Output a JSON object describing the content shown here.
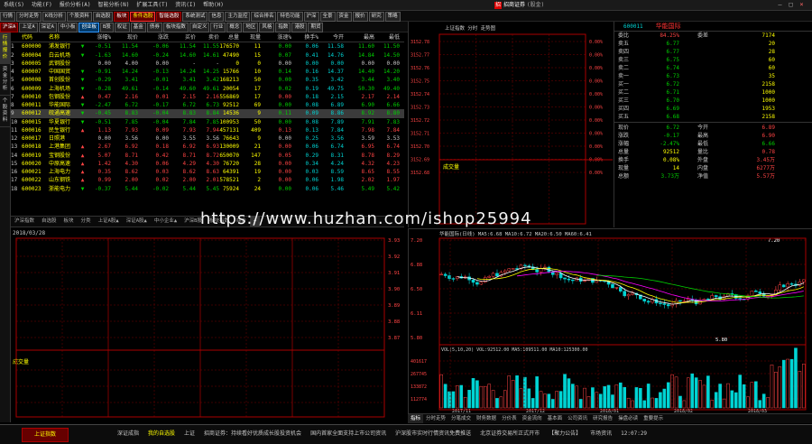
{
  "menu": {
    "items": [
      "系统(S)",
      "功能(F)",
      "报价分析(A)",
      "智能分析(N)",
      "扩展工具(T)",
      "资讯(I)",
      "帮助(H)"
    ],
    "brand": "招商证券",
    "brand_sub": "(股金)"
  },
  "toolbar1": [
    "行情",
    "分时走势",
    "K线分析",
    "个股资料",
    "自选股",
    "板块",
    "条件选股",
    "智能选股",
    "系统测试",
    "信息",
    "主力监控",
    "综合排名",
    "特色功能",
    "沪深",
    "全景",
    "资金",
    "报价",
    "研究",
    "策略"
  ],
  "toolbar2": [
    "沪深A",
    "上证A",
    "深证A",
    "中小板",
    "创业板",
    "B股",
    "权证",
    "基金",
    "债券",
    "板块指数",
    "自定义",
    "行业",
    "概念",
    "地区",
    "风格",
    "指数",
    "港股",
    "期货"
  ],
  "left_tabs": [
    "行情报价",
    "资金分析",
    "个股资料"
  ],
  "quotes": {
    "headers": [
      "",
      "代码",
      "名称",
      "",
      "涨幅%",
      "现价",
      "涨跌",
      "买价",
      "卖价",
      "总量",
      "现量",
      "涨速%",
      "换手%",
      "今开",
      "最高",
      "最低",
      "昨收",
      "市盈"
    ],
    "rows": [
      {
        "n": "1",
        "code": "600000",
        "name": "浦发银行",
        "f": "dn",
        "v": [
          "-0.51",
          "11.54",
          "-0.06",
          "11.54",
          "11.55",
          "176570",
          "11",
          "0.00",
          "0.06",
          "11.58",
          "11.60",
          "11.50",
          "11.60",
          "6.12"
        ]
      },
      {
        "n": "2",
        "code": "600004",
        "name": "白云机场",
        "f": "dn",
        "v": [
          "-1.63",
          "14.60",
          "-0.24",
          "14.60",
          "14.61",
          "47490",
          "15",
          "0.07",
          "0.41",
          "14.76",
          "14.84",
          "14.50",
          "14.84",
          "15.23"
        ]
      },
      {
        "n": "3",
        "code": "600005",
        "name": "武钢股份",
        "f": "fl",
        "v": [
          "0.00",
          "4.00",
          "0.00",
          "-",
          "-",
          "0",
          "0",
          "0.00",
          "0.00",
          "0.00",
          "0.00",
          "0.00",
          "4.00",
          "4.05"
        ]
      },
      {
        "n": "4",
        "code": "600007",
        "name": "中国国贸",
        "f": "dn",
        "v": [
          "-0.91",
          "14.24",
          "-0.13",
          "14.24",
          "14.25",
          "15766",
          "10",
          "0.14",
          "0.16",
          "14.37",
          "14.40",
          "14.20",
          "14.37",
          "20.88"
        ]
      },
      {
        "n": "5",
        "code": "600008",
        "name": "首创股份",
        "f": "dn",
        "v": [
          "-0.29",
          "3.41",
          "-0.01",
          "3.41",
          "3.42",
          "168213",
          "50",
          "0.00",
          "0.35",
          "3.42",
          "3.44",
          "3.40",
          "3.42",
          "25.14"
        ]
      },
      {
        "n": "6",
        "code": "600009",
        "name": "上海机场",
        "f": "dn",
        "v": [
          "-0.28",
          "49.61",
          "-0.14",
          "49.60",
          "49.61",
          "20054",
          "17",
          "0.02",
          "0.19",
          "49.75",
          "50.30",
          "49.40",
          "49.75",
          "30.70"
        ]
      },
      {
        "n": "7",
        "code": "600010",
        "name": "包钢股份",
        "f": "up",
        "v": [
          "0.47",
          "2.16",
          "0.01",
          "2.15",
          "2.16",
          "556869",
          "17",
          "0.00",
          "0.18",
          "2.15",
          "2.17",
          "2.14",
          "2.15",
          "215"
        ]
      },
      {
        "n": "8",
        "code": "600011",
        "name": "华能国际",
        "f": "dn",
        "v": [
          "-2.47",
          "6.72",
          "-0.17",
          "6.72",
          "6.73",
          "92512",
          "69",
          "0.00",
          "0.08",
          "6.89",
          "6.90",
          "6.66",
          "6.89",
          "14.09"
        ]
      },
      {
        "n": "9",
        "code": "600012",
        "name": "皖通高速",
        "f": "dn",
        "v": [
          "-0.45",
          "8.83",
          "-0.04",
          "8.83",
          "8.84",
          "14536",
          "9",
          "0.11",
          "0.09",
          "8.86",
          "8.92",
          "8.80",
          "8.87",
          "9.42"
        ]
      },
      {
        "n": "10",
        "code": "600015",
        "name": "华夏银行",
        "f": "dn",
        "v": [
          "-0.51",
          "7.85",
          "-0.04",
          "7.84",
          "7.85",
          "100953",
          "50",
          "0.00",
          "0.08",
          "7.89",
          "7.91",
          "7.83",
          "7.89",
          "6.89"
        ]
      },
      {
        "n": "11",
        "code": "600016",
        "name": "民生银行",
        "f": "up",
        "v": [
          "1.13",
          "7.93",
          "0.09",
          "7.93",
          "7.94",
          "457131",
          "409",
          "0.13",
          "0.13",
          "7.84",
          "7.98",
          "7.84",
          "7.84",
          "7.20"
        ]
      },
      {
        "n": "12",
        "code": "600017",
        "name": "日照港",
        "f": "fl",
        "v": [
          "0.00",
          "3.56",
          "0.00",
          "3.55",
          "3.56",
          "76643",
          "9",
          "0.00",
          "0.25",
          "3.56",
          "3.59",
          "3.53",
          "3.56",
          "39.19"
        ]
      },
      {
        "n": "13",
        "code": "600018",
        "name": "上港集团",
        "f": "up",
        "v": [
          "2.67",
          "6.92",
          "0.18",
          "6.92",
          "6.93",
          "130009",
          "21",
          "0.00",
          "0.06",
          "6.74",
          "6.95",
          "6.74",
          "6.74",
          "7.11"
        ]
      },
      {
        "n": "14",
        "code": "600019",
        "name": "宝钢股份",
        "f": "up",
        "v": [
          "5.07",
          "8.71",
          "0.42",
          "8.71",
          "8.72",
          "650070",
          "147",
          "0.05",
          "0.29",
          "8.31",
          "8.78",
          "8.29",
          "8.29",
          "8.68"
        ]
      },
      {
        "n": "15",
        "code": "600020",
        "name": "中原高速",
        "f": "up",
        "v": [
          "1.42",
          "4.30",
          "0.06",
          "4.29",
          "4.30",
          "76720",
          "28",
          "0.00",
          "0.34",
          "4.24",
          "4.32",
          "4.23",
          "4.24",
          "6.36"
        ]
      },
      {
        "n": "16",
        "code": "600021",
        "name": "上海电力",
        "f": "up",
        "v": [
          "0.35",
          "8.62",
          "0.03",
          "8.62",
          "8.63",
          "64391",
          "19",
          "0.00",
          "0.03",
          "8.59",
          "8.65",
          "8.55",
          "8.59",
          "10.33"
        ]
      },
      {
        "n": "17",
        "code": "600022",
        "name": "山东钢铁",
        "f": "up",
        "v": [
          "0.99",
          "2.00",
          "0.02",
          "2.00",
          "2.01",
          "578521",
          "2",
          "0.00",
          "0.06",
          "1.98",
          "2.02",
          "1.97",
          "1.98",
          "2.00"
        ]
      },
      {
        "n": "18",
        "code": "600023",
        "name": "浙能电力",
        "f": "dn",
        "v": [
          "-0.37",
          "5.44",
          "-0.02",
          "5.44",
          "5.45",
          "75924",
          "24",
          "0.00",
          "0.06",
          "5.46",
          "5.49",
          "5.42",
          "5.46",
          "16.01"
        ]
      }
    ]
  },
  "sheet_tabs": [
    "沪深指数",
    "自选股",
    "板块",
    "分类",
    "上证A股▲",
    "深证A股▲",
    "中小企业▲",
    "沪深B股",
    "板块指数",
    "综合",
    "+"
  ],
  "intraday": {
    "date": "2018/03/28",
    "label": "成交量",
    "yticks": [
      "3.93",
      "3.92",
      "3.91",
      "3.90",
      "3.89",
      "3.88",
      "3.87"
    ]
  },
  "mid_chart": {
    "title": "上证指数  分时  走势图",
    "yticks": [
      "3152.78",
      "3152.77",
      "3152.76",
      "3152.75",
      "3152.74",
      "3152.73",
      "3152.72",
      "3152.71",
      "3152.70",
      "3152.69",
      "3152.68"
    ],
    "pct": [
      "0.00%",
      "0.00%",
      "0.00%",
      "0.00%",
      "0.00%",
      "0.00%",
      "0.00%",
      "0.00%",
      "0.00%",
      "0.00%",
      "0.00%"
    ],
    "vol_label": "成交量"
  },
  "right_panel": {
    "code": "600011",
    "name": "华能国际",
    "rows": [
      [
        "委比",
        "84.25%",
        "委差",
        "7174"
      ],
      [
        "卖五",
        "6.77",
        "",
        "20"
      ],
      [
        "卖四",
        "6.77",
        "",
        "28"
      ],
      [
        "卖三",
        "6.75",
        "",
        "60"
      ],
      [
        "卖二",
        "6.74",
        "",
        "60"
      ],
      [
        "卖一",
        "6.73",
        "",
        "35"
      ],
      [
        "买一",
        "6.72",
        "",
        "2158"
      ],
      [
        "买二",
        "6.71",
        "",
        "1000"
      ],
      [
        "买三",
        "6.70",
        "",
        "1000"
      ],
      [
        "买四",
        "6.69",
        "",
        "1953"
      ],
      [
        "买五",
        "6.68",
        "",
        "2158"
      ]
    ],
    "stats": [
      [
        "现价",
        "6.72",
        "今开",
        "6.89"
      ],
      [
        "涨跌",
        "-0.17",
        "最高",
        "6.90"
      ],
      [
        "涨幅",
        "-2.47%",
        "最低",
        "6.66"
      ],
      [
        "总量",
        "92512",
        "量比",
        "0.78"
      ],
      [
        "换手",
        "0.08%",
        "外盘",
        "3.45万"
      ],
      [
        "现量",
        "14",
        "内盘",
        "6277万"
      ],
      [
        "总额",
        "3.73万",
        "净值",
        "5.57万"
      ]
    ]
  },
  "kline": {
    "title": "华能国际(日线)  MA5:6.68  MA10:6.72  MA20:6.50  MA60:6.41",
    "yticks": [
      "7.20",
      "6.88",
      "6.50",
      "6.11",
      "5.80"
    ],
    "hi_label": "7.20",
    "lo_label": "5.80",
    "vol_title": "VOL(5,10,20)  VOL:92512.00  MA5:109511.00  MA10:125300.00",
    "vol_ticks": [
      "401617",
      "267745",
      "133872",
      "112774"
    ],
    "months": [
      "2017/11",
      "2017/12",
      "2018/01",
      "2018/02",
      "2018/03"
    ],
    "tabs": [
      "指标",
      "分时走势",
      "分笔成交",
      "财务数据",
      "分价表",
      "资金流向",
      "基本面",
      "公司资讯",
      "研究报告",
      "操盘必读",
      "重要提示"
    ]
  },
  "status": {
    "left_btn": "上证指数",
    "items": [
      "深证成指",
      "我的自选股",
      "上证",
      "招商证券：持续看好优质成长股投资机会",
      "国内首家全面支持上市公司资讯",
      "沪深股市实时行情资讯免费推送",
      "北京证券交易所正式开市",
      "【聚力公告】",
      "市场资讯",
      "12:07:29"
    ],
    "time": "12:07:29"
  },
  "watermark": "https://www.huzhan.com/ishop25994",
  "colors": {
    "up": "#ff4444",
    "down": "#00d000",
    "text": "#c8c8c8",
    "yellow": "#ffff00",
    "cyan": "#00d4d4",
    "grid": "#7a0000"
  }
}
